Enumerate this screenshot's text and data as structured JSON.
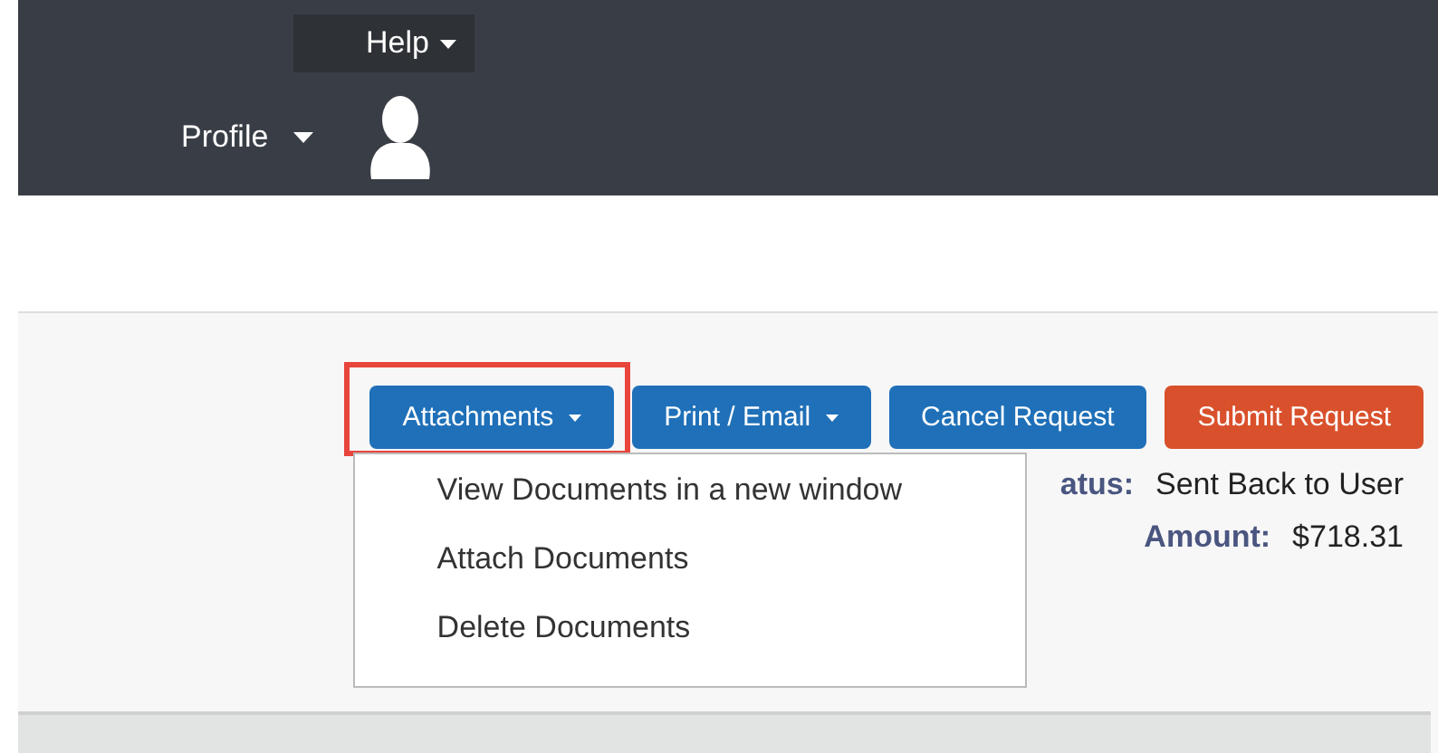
{
  "header": {
    "help": "Help",
    "profile": "Profile"
  },
  "actions": [
    {
      "label": "Attachments",
      "kind": "primary",
      "has_menu": true,
      "expanded": true,
      "highlighted": true
    },
    {
      "label": "Print / Email",
      "kind": "primary",
      "has_menu": true,
      "expanded": false,
      "highlighted": false
    },
    {
      "label": "Cancel Request",
      "kind": "primary",
      "has_menu": false,
      "expanded": false,
      "highlighted": false
    },
    {
      "label": "Submit Request",
      "kind": "submit",
      "has_menu": false,
      "expanded": false,
      "highlighted": false
    }
  ],
  "menu": [
    "View Documents in a new window",
    "Attach Documents",
    "Delete Documents"
  ],
  "details": [
    {
      "label": "atus:",
      "value": "Sent Back to User"
    },
    {
      "label": "Amount:",
      "value": "$718.31"
    }
  ]
}
